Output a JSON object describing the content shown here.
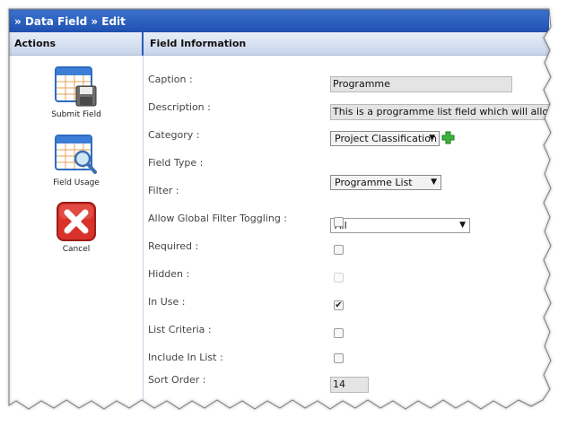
{
  "title": "» Data Field » Edit",
  "actions_header": "Actions",
  "info_header": "Field Information",
  "actions": [
    {
      "label": "Submit Field",
      "icon": "submit-field-icon"
    },
    {
      "label": "Field Usage",
      "icon": "field-usage-icon"
    },
    {
      "label": "Cancel",
      "icon": "cancel-icon"
    }
  ],
  "fields": {
    "caption": {
      "label": "Caption :",
      "value": "Programme"
    },
    "description": {
      "label": "Description :",
      "value": "This is a programme list field which will allow pro"
    },
    "category": {
      "label": "Category :",
      "value": "Project Classification"
    },
    "field_type": {
      "label": "Field Type :",
      "value": "Programme List"
    },
    "filter": {
      "label": "Filter :",
      "value": "All"
    },
    "allow_global_filter": {
      "label": "Allow Global Filter Toggling :",
      "checked": false
    },
    "required": {
      "label": "Required :",
      "checked": false
    },
    "hidden": {
      "label": "Hidden :",
      "checked": false,
      "disabled": true
    },
    "in_use": {
      "label": "In Use :",
      "checked": true
    },
    "list_criteria": {
      "label": "List Criteria :",
      "checked": false
    },
    "include_in_list": {
      "label": "Include In List :",
      "checked": false
    },
    "sort_order": {
      "label": "Sort Order :",
      "value": "14"
    }
  },
  "colors": {
    "title_bar": "#2c5fc0",
    "header_bg": "#d9e3f3",
    "add_icon": "#3cb43c",
    "cancel_red": "#d8322a"
  }
}
